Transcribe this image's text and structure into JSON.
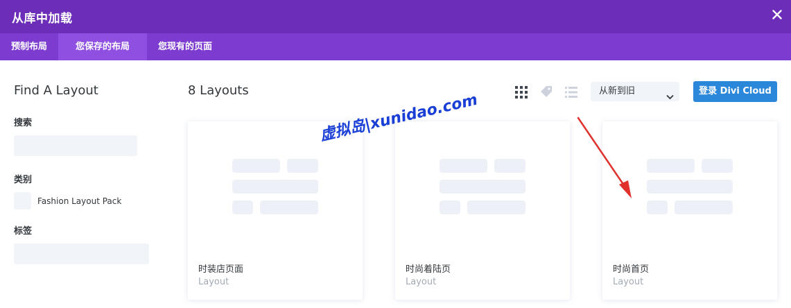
{
  "window": {
    "title": "从库中加载"
  },
  "tabs": [
    {
      "label": "预制布局"
    },
    {
      "label": "您保存的布局"
    },
    {
      "label": "您现有的页面"
    }
  ],
  "sidebar": {
    "heading": "Find A Layout",
    "search_label": "搜索",
    "category_label": "类别",
    "category_option": "Fashion Layout Pack",
    "tags_label": "标签"
  },
  "main": {
    "count": "8 Layouts",
    "sort_value": "从新到旧",
    "login_button": "登录 Divi Cloud",
    "view_icons": [
      "grid-view-icon",
      "tag-icon",
      "list-view-icon"
    ]
  },
  "cards": [
    {
      "name": "时装店页面",
      "type": "Layout"
    },
    {
      "name": "时尚着陆页",
      "type": "Layout"
    },
    {
      "name": "时尚首页",
      "type": "Layout"
    }
  ],
  "watermark": "虚拟岛|xunidao.com",
  "colors": {
    "title_bar": "#6c2eb9",
    "tab_bar": "#7d3bd0",
    "active_tab": "#8f4fe0",
    "primary_button": "#2b87da",
    "annotation_arrow": "#e0312c"
  }
}
